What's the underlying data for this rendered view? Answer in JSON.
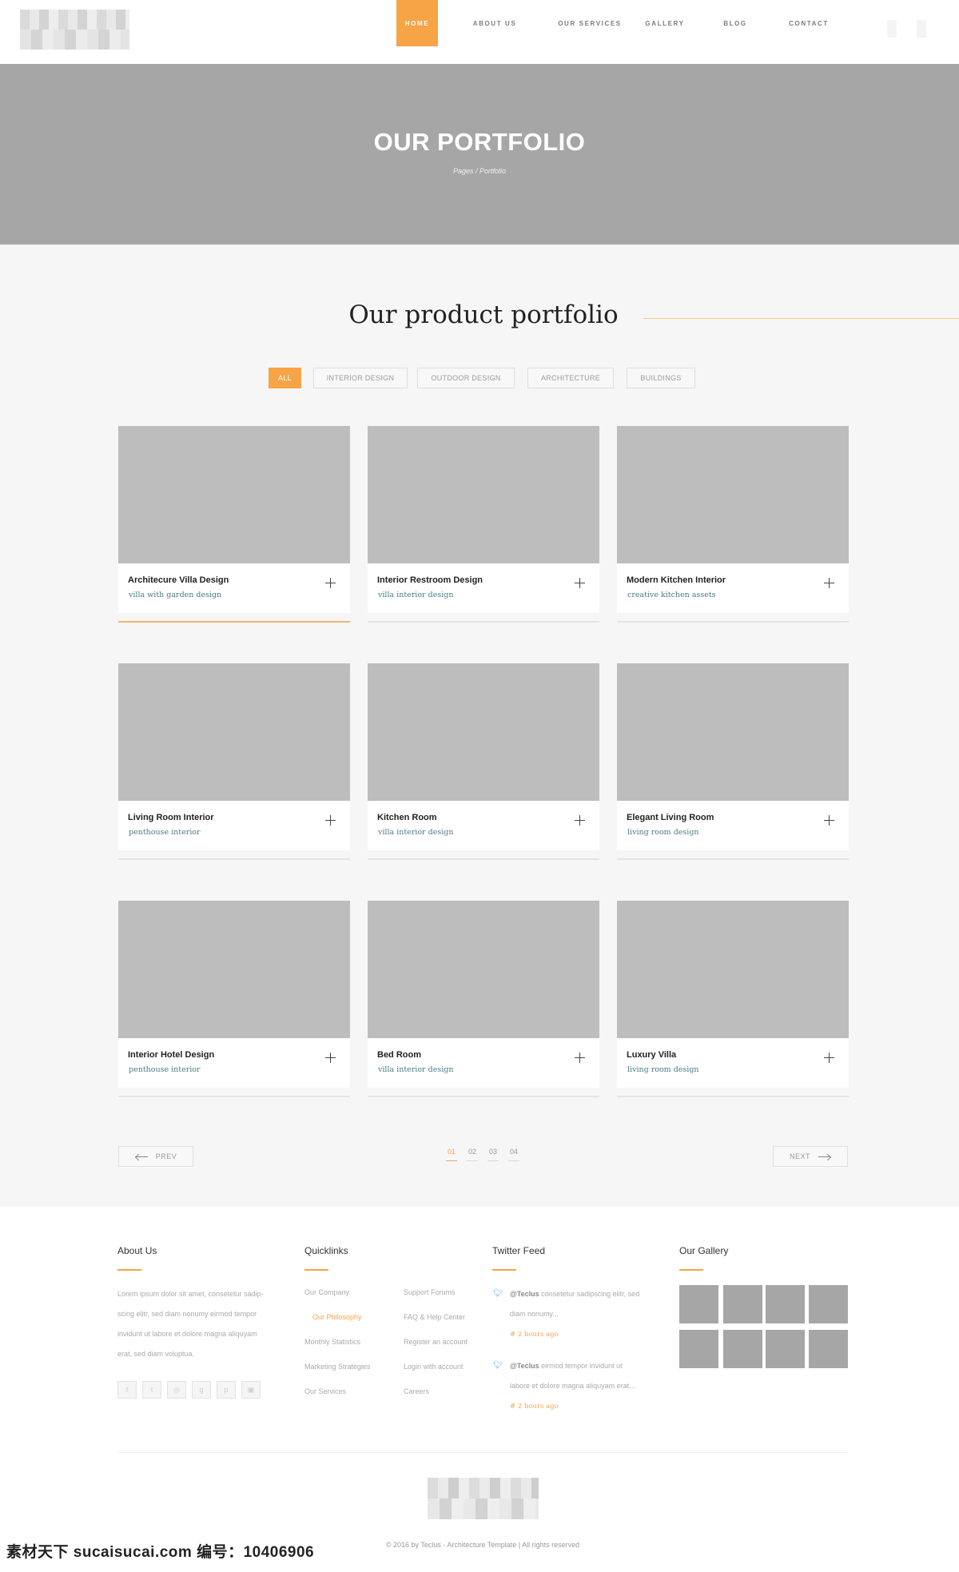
{
  "nav": {
    "menu": [
      "HOME",
      "ABOUT US",
      "OUR SERVICES",
      "GALLERY",
      "BLOG",
      "CONTACT"
    ],
    "active": "HOME"
  },
  "hero": {
    "title": "OUR PORTFOLIO",
    "breadcrumb": "Pages / Portfolio"
  },
  "portfolio": {
    "title": "Our product portfolio",
    "filters": [
      "ALL",
      "INTERIOR DESIGN",
      "OUTDOOR DESIGN",
      "ARCHITECTURE",
      "BUILDINGS"
    ],
    "active_filter": "ALL",
    "items": [
      {
        "title": "Architecure Villa Design",
        "subtitle": "villa with garden design",
        "active": true
      },
      {
        "title": "Interior Restroom Design",
        "subtitle": "villa interior design"
      },
      {
        "title": "Modern Kitchen Interior",
        "subtitle": "creative kitchen assets"
      },
      {
        "title": "Living Room Interior",
        "subtitle": "penthouse interior"
      },
      {
        "title": "Kitchen Room",
        "subtitle": "villa interior design"
      },
      {
        "title": "Elegant Living Room",
        "subtitle": "living room design"
      },
      {
        "title": "Interior Hotel Design",
        "subtitle": "penthouse interior"
      },
      {
        "title": "Bed Room",
        "subtitle": "villa interior design"
      },
      {
        "title": "Luxury Villa",
        "subtitle": "living room design"
      }
    ]
  },
  "pagination": {
    "prev": "PREV",
    "next": "NEXT",
    "pages": [
      "01",
      "02",
      "03",
      "04"
    ],
    "active_page": "01"
  },
  "footer": {
    "about": {
      "title": "About Us",
      "lines": [
        "Lorem ipsum dolor sit amet, consetetur sadip-",
        "scing elitr, sed diam nonumy eirmod tempor",
        "invidunt ut labore et dolore magna aliquyam",
        "erat, sed diam voluptua."
      ],
      "social": [
        "f",
        "t",
        "◎",
        "g",
        "p",
        "▣"
      ]
    },
    "quicklinks": {
      "title": "Quicklinks",
      "col1": [
        "Our Company",
        "Our Philosophy",
        "Monthly Statistics",
        "Marketing Strategies",
        "Our Services"
      ],
      "col2": [
        "Support Forums",
        "FAQ & Help Center",
        "Register an account",
        "Login with account",
        "Careers"
      ],
      "highlighted": "Our Philosophy"
    },
    "twitter": {
      "title": "Twitter Feed",
      "tweets": [
        {
          "handle": "@Teclus",
          "text_1": " consetetur sadipscing elitr, sed",
          "text_2": "diam nonumy...",
          "time": "# 2 hours ago"
        },
        {
          "handle": "@Teclus",
          "text_1": " eirmod tempor invidunt ut",
          "text_2": "labore et dolore magna aliquyam erat...",
          "time": "# 2 hours ago"
        }
      ]
    },
    "gallery": {
      "title": "Our Gallery",
      "count": 8
    },
    "copyright": "© 2016 by Teclus - Architecture Template | All rights reserved"
  },
  "watermark": "素材天下 sucaisucai.com  编号：10406906",
  "colors": {
    "accent": "#f7a446",
    "hero_bg": "#a6a6a6",
    "placeholder": "#bdbdbd",
    "subtitle": "#4a7a86",
    "twitter": "#55acee"
  }
}
